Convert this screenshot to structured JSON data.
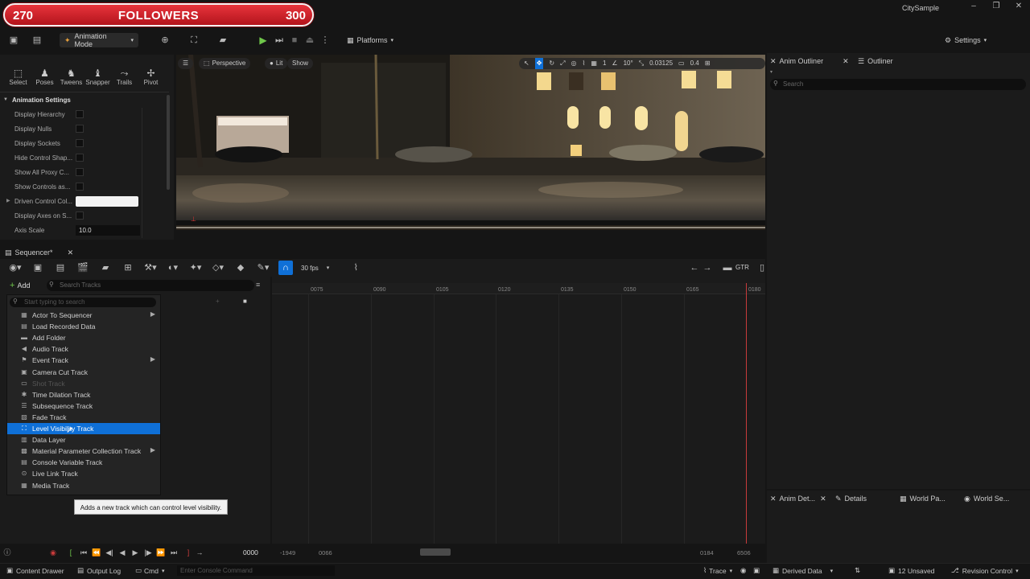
{
  "overlay": {
    "left_count": "270",
    "label": "FOLLOWERS",
    "right_count": "300"
  },
  "window": {
    "project": "CitySample",
    "minimize": "–",
    "maximize": "❐",
    "close": "✕"
  },
  "toolbar": {
    "mode": "Animation Mode",
    "platforms": "Platforms",
    "settings": "Settings"
  },
  "anim_tools": {
    "items": [
      "Select",
      "Poses",
      "Tweens",
      "Snapper",
      "Trails",
      "Pivot"
    ]
  },
  "anim_settings": {
    "header": "Animation Settings",
    "rows": [
      "Display Hierarchy",
      "Display Nulls",
      "Display Sockets",
      "Hide Control Shap...",
      "Show All Proxy C...",
      "Show Controls as...",
      "Driven Control Col...",
      "Display Axes on S...",
      "Axis Scale"
    ],
    "axis_scale_value": "10.0"
  },
  "viewport": {
    "perspective": "Perspective",
    "lit": "Lit",
    "show": "Show",
    "grid_value": "1",
    "angle_value": "10°",
    "scale_value": "0.03125",
    "speed_value": "0.4"
  },
  "outliner": {
    "tab_anim": "Anim Outliner",
    "tab_outliner": "Outliner",
    "search_placeholder": "Search"
  },
  "details": {
    "tab_anim": "Anim Det...",
    "tab_details": "Details",
    "tab_world_partition": "World Pa...",
    "tab_world_settings": "World Se..."
  },
  "sequencer": {
    "tab": "Sequencer*",
    "fps": "30 fps",
    "gtr": "GTR",
    "add": "Add",
    "search_placeholder": "Search Tracks",
    "ticks": [
      "0075",
      "0090",
      "0105",
      "0120",
      "0135",
      "0150",
      "0165",
      "0180"
    ]
  },
  "menu": {
    "search_placeholder": "Start typing to search",
    "items": [
      {
        "label": "Actor To Sequencer",
        "icon": "▦",
        "arrow": true,
        "disabled": false,
        "selected": false
      },
      {
        "label": "Load Recorded Data",
        "icon": "▤",
        "arrow": false,
        "disabled": false,
        "selected": false
      },
      {
        "label": "Add Folder",
        "icon": "▬",
        "arrow": false,
        "disabled": false,
        "selected": false
      },
      {
        "label": "Audio Track",
        "icon": "◀",
        "arrow": false,
        "disabled": false,
        "selected": false
      },
      {
        "label": "Event Track",
        "icon": "⚑",
        "arrow": true,
        "disabled": false,
        "selected": false
      },
      {
        "label": "Camera Cut Track",
        "icon": "▣",
        "arrow": false,
        "disabled": false,
        "selected": false
      },
      {
        "label": "Shot Track",
        "icon": "▭",
        "arrow": false,
        "disabled": true,
        "selected": false
      },
      {
        "label": "Time Dilation Track",
        "icon": "✱",
        "arrow": false,
        "disabled": false,
        "selected": false
      },
      {
        "label": "Subsequence Track",
        "icon": "☰",
        "arrow": false,
        "disabled": false,
        "selected": false
      },
      {
        "label": "Fade Track",
        "icon": "▧",
        "arrow": false,
        "disabled": false,
        "selected": false
      },
      {
        "label": "Level Visibility Track",
        "icon": "⛶",
        "arrow": false,
        "disabled": false,
        "selected": true
      },
      {
        "label": "Data Layer",
        "icon": "▥",
        "arrow": false,
        "disabled": false,
        "selected": false
      },
      {
        "label": "Material Parameter Collection Track",
        "icon": "▩",
        "arrow": true,
        "disabled": false,
        "selected": false
      },
      {
        "label": "Console Variable Track",
        "icon": "▤",
        "arrow": false,
        "disabled": false,
        "selected": false
      },
      {
        "label": "Live Link Track",
        "icon": "⊙",
        "arrow": false,
        "disabled": false,
        "selected": false
      },
      {
        "label": "Media Track",
        "icon": "▦",
        "arrow": false,
        "disabled": false,
        "selected": false
      }
    ],
    "tooltip": "Adds a new track which can control level visibility."
  },
  "transport": {
    "frame": "0000",
    "range_start": "-1949",
    "view_start": "0066",
    "view_end": "0184",
    "range_end": "6506"
  },
  "statusbar": {
    "content_drawer": "Content Drawer",
    "output_log": "Output Log",
    "cmd": "Cmd",
    "console_placeholder": "Enter Console Command",
    "trace": "Trace",
    "derived_data": "Derived Data",
    "unsaved": "12 Unsaved",
    "revision_control": "Revision Control"
  },
  "colors": {
    "accent": "#0f70d7",
    "overlay_red": "#d0202a",
    "playhead": "#c83b3b",
    "play_green": "#6fc64a"
  }
}
